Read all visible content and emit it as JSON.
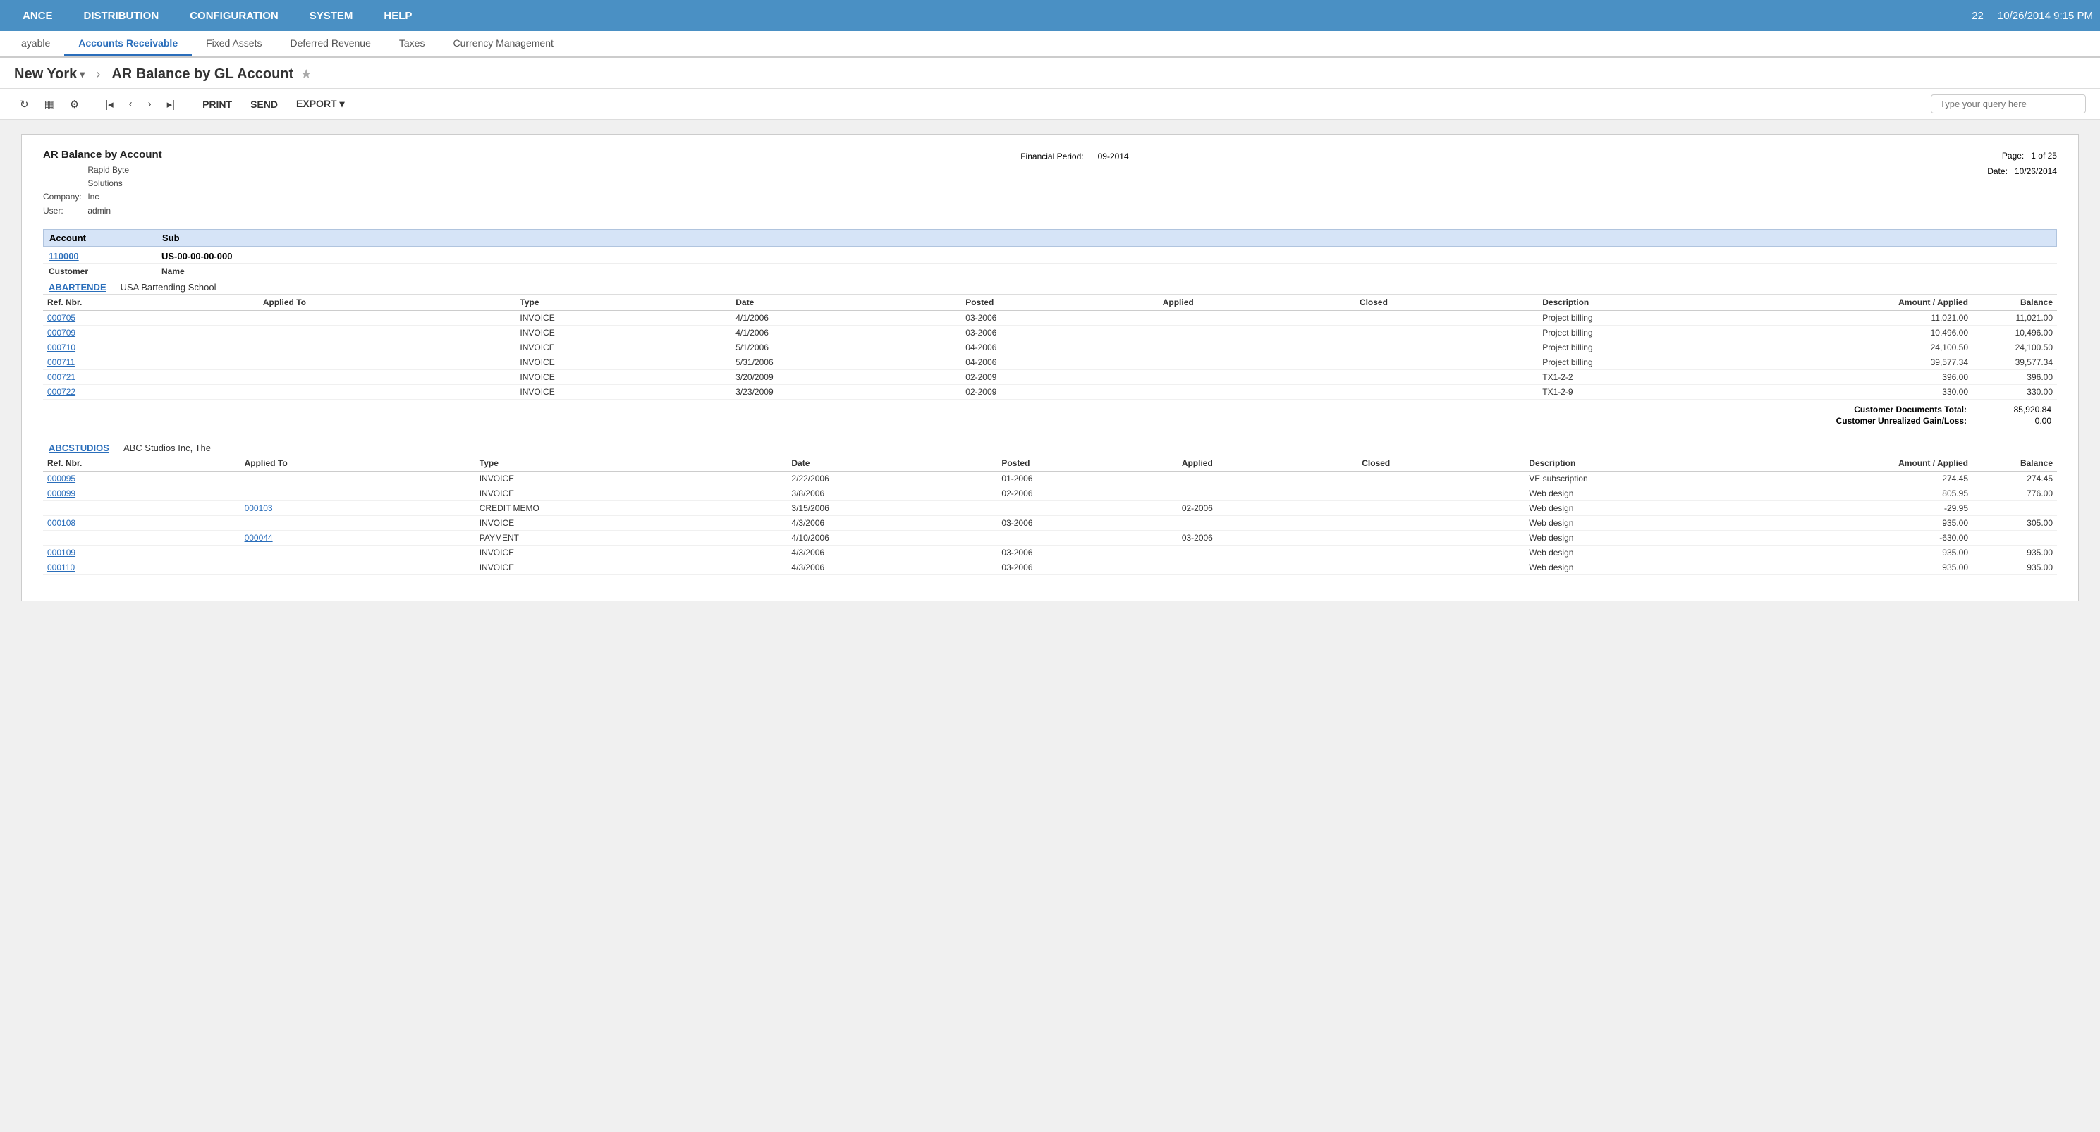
{
  "topNav": {
    "items": [
      "ANCE",
      "DISTRIBUTION",
      "CONFIGURATION",
      "SYSTEM",
      "HELP"
    ],
    "badge": "22",
    "datetime": "10/26/2014  9:15 PM"
  },
  "subNav": {
    "tabs": [
      "ayable",
      "Accounts Receivable",
      "Fixed Assets",
      "Deferred Revenue",
      "Taxes",
      "Currency Management"
    ],
    "activeTab": "Accounts Receivable"
  },
  "pageTitleBar": {
    "company": "New York",
    "chevron": "▾",
    "separator": "AR Balance by GL Account",
    "star": "★"
  },
  "toolbar": {
    "refreshLabel": "C",
    "printLabel": "PRINT",
    "sendLabel": "SEND",
    "exportLabel": "EXPORT",
    "exportChevron": "▾",
    "queryPlaceholder": "Type your query here"
  },
  "report": {
    "title": "AR Balance by Account",
    "company": {
      "label": "Company:",
      "value": "Rapid Byte Solutions Inc"
    },
    "user": {
      "label": "User:",
      "value": "admin"
    },
    "financialPeriod": {
      "label": "Financial Period:",
      "value": "09-2014"
    },
    "page": {
      "label": "Page:",
      "value": "1 of 25"
    },
    "date": {
      "label": "Date:",
      "value": "10/26/2014"
    },
    "columns": {
      "account": "Account",
      "sub": "Sub"
    },
    "accountSection": {
      "accountId": "110000",
      "accountSub": "US-00-00-00-000",
      "customerLabel": "Customer",
      "nameLabel": "Name",
      "customers": [
        {
          "id": "ABARTENDE",
          "name": "USA Bartending School",
          "transactions": [
            {
              "refNbr": "000705",
              "appliedTo": "",
              "type": "INVOICE",
              "date": "4/1/2006",
              "posted": "03-2006",
              "applied": "",
              "closed": "",
              "description": "Project billing",
              "amount": "11,021.00",
              "balance": "11,021.00"
            },
            {
              "refNbr": "000709",
              "appliedTo": "",
              "type": "INVOICE",
              "date": "4/1/2006",
              "posted": "03-2006",
              "applied": "",
              "closed": "",
              "description": "Project billing",
              "amount": "10,496.00",
              "balance": "10,496.00"
            },
            {
              "refNbr": "000710",
              "appliedTo": "",
              "type": "INVOICE",
              "date": "5/1/2006",
              "posted": "04-2006",
              "applied": "",
              "closed": "",
              "description": "Project billing",
              "amount": "24,100.50",
              "balance": "24,100.50"
            },
            {
              "refNbr": "000711",
              "appliedTo": "",
              "type": "INVOICE",
              "date": "5/31/2006",
              "posted": "04-2006",
              "applied": "",
              "closed": "",
              "description": "Project billing",
              "amount": "39,577.34",
              "balance": "39,577.34"
            },
            {
              "refNbr": "000721",
              "appliedTo": "",
              "type": "INVOICE",
              "date": "3/20/2009",
              "posted": "02-2009",
              "applied": "",
              "closed": "",
              "description": "TX1-2-2",
              "amount": "396.00",
              "balance": "396.00"
            },
            {
              "refNbr": "000722",
              "appliedTo": "",
              "type": "INVOICE",
              "date": "3/23/2009",
              "posted": "02-2009",
              "applied": "",
              "closed": "",
              "description": "TX1-2-9",
              "amount": "330.00",
              "balance": "330.00"
            }
          ],
          "documentsTotal": "85,920.84",
          "unrealizedGainLoss": "0.00"
        },
        {
          "id": "ABCSTUDIOS",
          "name": "ABC Studios Inc, The",
          "transactions": [
            {
              "refNbr": "000095",
              "appliedTo": "",
              "type": "INVOICE",
              "date": "2/22/2006",
              "posted": "01-2006",
              "applied": "",
              "closed": "",
              "description": "VE subscription",
              "amount": "274.45",
              "balance": "274.45"
            },
            {
              "refNbr": "000099",
              "appliedTo": "",
              "type": "INVOICE",
              "date": "3/8/2006",
              "posted": "02-2006",
              "applied": "",
              "closed": "",
              "description": "Web design",
              "amount": "805.95",
              "balance": "776.00"
            },
            {
              "refNbr": "",
              "appliedTo": "000103",
              "type": "CREDIT MEMO",
              "date": "3/15/2006",
              "posted": "",
              "applied": "02-2006",
              "closed": "",
              "description": "Web design",
              "amount": "-29.95",
              "balance": ""
            },
            {
              "refNbr": "000108",
              "appliedTo": "",
              "type": "INVOICE",
              "date": "4/3/2006",
              "posted": "03-2006",
              "applied": "",
              "closed": "",
              "description": "Web design",
              "amount": "935.00",
              "balance": "305.00"
            },
            {
              "refNbr": "",
              "appliedTo": "000044",
              "type": "PAYMENT",
              "date": "4/10/2006",
              "posted": "",
              "applied": "03-2006",
              "closed": "",
              "description": "Web design",
              "amount": "-630.00",
              "balance": ""
            },
            {
              "refNbr": "000109",
              "appliedTo": "",
              "type": "INVOICE",
              "date": "4/3/2006",
              "posted": "03-2006",
              "applied": "",
              "closed": "",
              "description": "Web design",
              "amount": "935.00",
              "balance": "935.00"
            },
            {
              "refNbr": "000110",
              "appliedTo": "",
              "type": "INVOICE",
              "date": "4/3/2006",
              "posted": "03-2006",
              "applied": "",
              "closed": "",
              "description": "Web design",
              "amount": "935.00",
              "balance": "935.00"
            }
          ],
          "documentsTotal": "",
          "unrealizedGainLoss": ""
        }
      ]
    }
  },
  "txnHeaders": {
    "refNbr": "Ref. Nbr.",
    "appliedTo": "Applied To",
    "type": "Type",
    "date": "Date",
    "posted": "Posted",
    "applied": "Applied",
    "closed": "Closed",
    "description": "Description",
    "amountApplied": "Amount / Applied",
    "balance": "Balance"
  },
  "customerTotals": {
    "documentsLabel": "Customer Documents Total:",
    "gainLossLabel": "Customer Unrealized Gain/Loss:"
  }
}
